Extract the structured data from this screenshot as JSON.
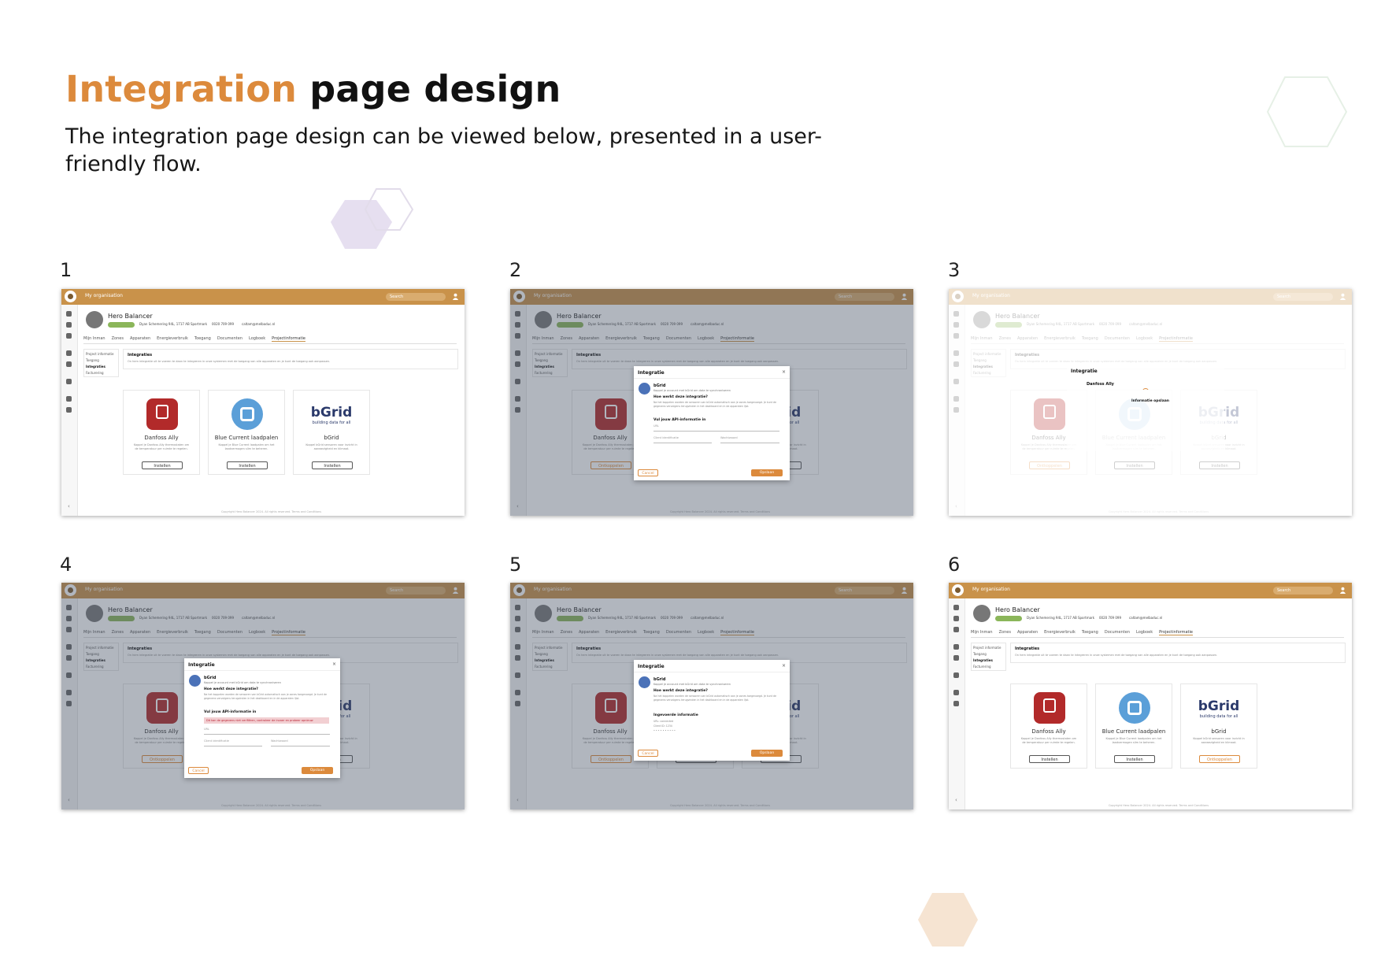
{
  "heading": {
    "accent": "Integration",
    "rest": " page design"
  },
  "subtitle": "The integration page design can be viewed below, presented in a user-friendly flow.",
  "colors": {
    "accent": "#dc8a3c",
    "topbar": "#c9924a",
    "active_badge": "#8bb65a",
    "danfoss": "#b22a2a",
    "blue_current": "#5b9fd8",
    "bgrid": "#2b3a6b"
  },
  "steps": [
    "1",
    "2",
    "3",
    "4",
    "5",
    "6"
  ],
  "app": {
    "org": "My organisation",
    "search": "Search",
    "project_name": "Hero Balancer",
    "address": "Dyan Schemering 94L, 1717 AB Sportmark",
    "phone": "0020 709 099",
    "email": "caltam@melbaduc.nl",
    "tabs": [
      "Mijn Inman",
      "Zones",
      "Apparaten",
      "Energieverbruik",
      "Toegang",
      "Documenten",
      "Logboek",
      "Projectinformatie"
    ],
    "side_menu": [
      "Project informatie",
      "Toegang",
      "Integraties",
      "Facturering"
    ],
    "panel_title": "Integraties",
    "panel_text": "On hem integratie uit te voeren te daan te integreren in onze systemen met de toegang van alle apparaten en je kunt de toegang ook aanpassen.",
    "footer": "Copyright Hero Balancer 2024. All rights reserved. Terms and Conditions"
  },
  "integrations": [
    {
      "name": "Danfoss Ally",
      "desc": "Koppel je Danfoss Ally thermostaten om de temperatuur per ruimte te regelen.",
      "button": "Instellen"
    },
    {
      "name": "Blue Current laadpalen",
      "desc": "Koppel je Blue Current laadpalen om het laadvermogen slim te beheren.",
      "button": "Instellen"
    },
    {
      "name": "bGrid",
      "logo": "bGrid",
      "tagline": "building data for all",
      "desc": "Koppel bGrid sensoren voor inzicht in aanwezigheid en klimaat.",
      "button": "Instellen"
    }
  ],
  "connected_button": "Ontkoppelen",
  "modal": {
    "title": "Integratie",
    "close": "×",
    "vendor": "bGrid",
    "vendor_sub": "Koppel je account met bGrid om data te synchroniseren",
    "how_title": "Hoe werkt deze integratie?",
    "how_text": "Na het koppelen worden de sensoren van bGrid automatisch aan je zones toegevoegd. Je kunt de gegevens vervolgens terugvinden in het dashboard en in de apparaten lijst.",
    "required_title": "Vul jouw API-informatie in",
    "error": "Dit kan de gegevens niet verifiëren, controleer de invoer en probeer opnieuw",
    "url_label": "URL",
    "client_label": "Client identificatie",
    "secret_label": "Wachtwoord",
    "cancel": "Cancel",
    "save": "Opslaan",
    "loading": "Informatie opslaan",
    "summary_title": "Ingevoerde informatie",
    "summary_url": "URL: connected",
    "summary_client": "Client ID: 1234",
    "summary_secret": "• • • • • • • • • •"
  }
}
